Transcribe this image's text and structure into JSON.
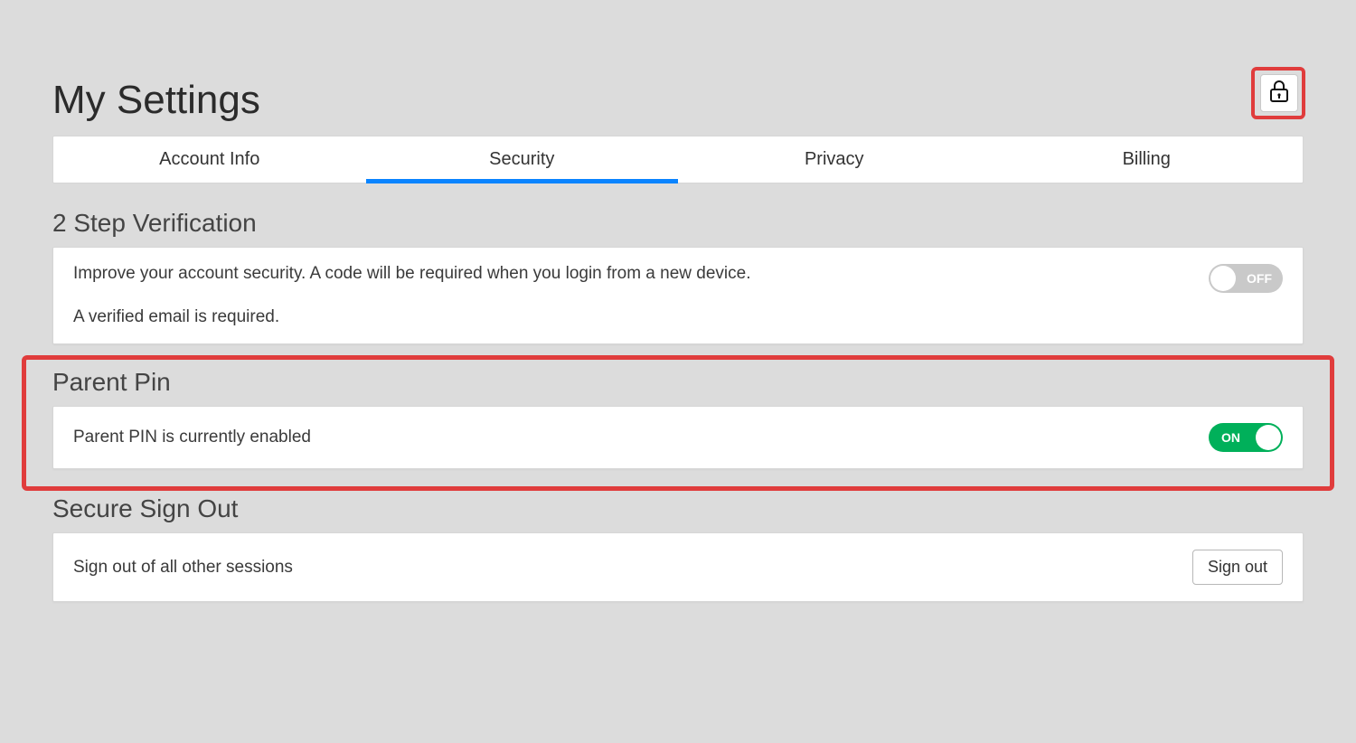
{
  "page": {
    "title": "My Settings"
  },
  "tabs": {
    "account_info": "Account Info",
    "security": "Security",
    "privacy": "Privacy",
    "billing": "Billing",
    "active": "security"
  },
  "sections": {
    "two_step": {
      "heading": "2 Step Verification",
      "description": "Improve your account security. A code will be required when you login from a new device.",
      "note": "A verified email is required.",
      "toggle_label": "OFF",
      "toggle_state": "off"
    },
    "parent_pin": {
      "heading": "Parent Pin",
      "description": "Parent PIN is currently enabled",
      "toggle_label": "ON",
      "toggle_state": "on"
    },
    "secure_signout": {
      "heading": "Secure Sign Out",
      "description": "Sign out of all other sessions",
      "button_label": "Sign out"
    }
  },
  "icons": {
    "lock": "lock-icon"
  },
  "colors": {
    "accent": "#0a84ff",
    "toggle_on": "#00b05a",
    "toggle_off": "#c9c9c9",
    "highlight": "#e03c3c"
  }
}
